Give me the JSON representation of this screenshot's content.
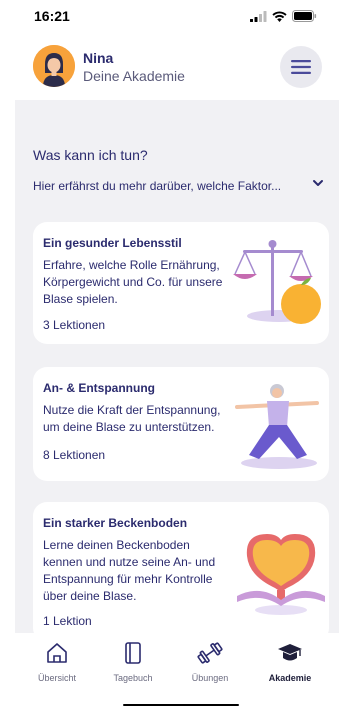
{
  "status": {
    "time": "16:21"
  },
  "header": {
    "name": "Nina",
    "subtitle": "Deine Akademie"
  },
  "section": {
    "title": "Was kann ich tun?",
    "description": "Hier erfährst du mehr darüber, welche Faktor..."
  },
  "cards": [
    {
      "title": "Ein gesunder Lebensstil",
      "description": "Erfahre, welche Rolle Ernährung, Körpergewicht und Co. für unsere Blase spielen.",
      "meta": "3 Lektionen"
    },
    {
      "title": "An- & Entspannung",
      "description": "Nutze die Kraft der Entspannung, um deine Blase zu unterstützen.",
      "meta": "8 Lektionen"
    },
    {
      "title": "Ein starker Beckenboden",
      "description": "Lerne deinen Beckenboden kennen und nutze seine An- und Entspannung für mehr Kontrolle über deine Blase.",
      "meta": "1 Lektion"
    }
  ],
  "tabs": [
    {
      "label": "Übersicht",
      "icon": "home-icon",
      "active": false
    },
    {
      "label": "Tagebuch",
      "icon": "notebook-icon",
      "active": false
    },
    {
      "label": "Übungen",
      "icon": "dumbbell-icon",
      "active": false
    },
    {
      "label": "Akademie",
      "icon": "graduation-cap-icon",
      "active": true
    }
  ],
  "colors": {
    "primary": "#2b2b6e",
    "accent": "#8b7ad1",
    "background": "#f1f1f4"
  }
}
